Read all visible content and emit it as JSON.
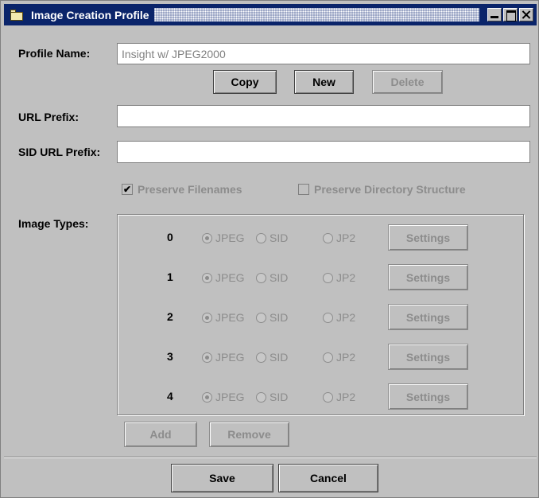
{
  "window": {
    "title": "Image Creation Profile"
  },
  "form": {
    "profile_name_label": "Profile Name:",
    "profile_name_value": "Insight w/ JPEG2000",
    "copy_label": "Copy",
    "new_label": "New",
    "delete_label": "Delete",
    "url_prefix_label": "URL Prefix:",
    "url_prefix_value": "",
    "sid_url_prefix_label": "SID URL Prefix:",
    "sid_url_prefix_value": "",
    "preserve_filenames_label": "Preserve Filenames",
    "preserve_filenames_checked": true,
    "preserve_dir_label": "Preserve Directory Structure",
    "preserve_dir_checked": false,
    "check_glyph": "✔",
    "image_types_label": "Image Types:"
  },
  "image_types": {
    "jpeg_label": "JPEG",
    "sid_label": "SID",
    "jp2_label": "JP2",
    "settings_label": "Settings",
    "rows": [
      {
        "index": "0",
        "selected": "JPEG"
      },
      {
        "index": "1",
        "selected": "JPEG"
      },
      {
        "index": "2",
        "selected": "JPEG"
      },
      {
        "index": "3",
        "selected": "JPEG"
      },
      {
        "index": "4",
        "selected": "JPEG"
      }
    ],
    "add_label": "Add",
    "remove_label": "Remove"
  },
  "footer": {
    "save_label": "Save",
    "cancel_label": "Cancel"
  }
}
